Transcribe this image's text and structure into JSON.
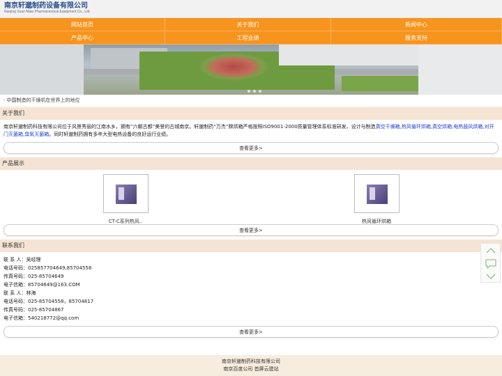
{
  "header": {
    "company_cn": "南京轩邈制药设备有限公司",
    "company_en": "Nanjing Xuan Miao Pharmaceutical Equipment Co., Ltd."
  },
  "nav": [
    "网站首页",
    "关于我们",
    "新闻中心",
    "产品中心",
    "工程业绩",
    "服务支持"
  ],
  "banner": {
    "caption": "· 中国制造的干燥机在世界上的地位"
  },
  "about": {
    "title": "关于我们",
    "text_before": "南京轩邈制药科技有限公司位于风景秀丽的江南水乡，拥有“六朝古都”美誉的古城南京。轩邈制药“万杰”牌烘箱严格按照ISO9001-2000质量管理体系标准研发、设计与制造",
    "links": "真空干燥箱,热风循环烘箱,真空烘箱,电热鼓风烘箱,对开门灭菌箱,臭氧灭菌箱",
    "text_after": "。同时轩邈制药拥有多年大型电热设备的良好运行业绩。",
    "more": "查看更多>"
  },
  "products": {
    "title": "产品展示",
    "items": [
      {
        "name": "CT-C系列热风.."
      },
      {
        "name": "热风循环烘箱"
      }
    ],
    "more": "查看更多>"
  },
  "contact": {
    "title": "联系我们",
    "lines": [
      "联 系 人：吴经理",
      "电话号码：025857704649,85704558",
      "传真号码：025-85704649",
      "电子信箱：85704649@163.COM",
      "联 系 人：林海",
      "电话号码：025-85704558，85704817",
      "传真号码：025-85704867",
      "电子信箱：540218772@qq.com"
    ],
    "more": "查看更多>"
  },
  "footer": {
    "line1": "南京轩邈制药科技有限公司",
    "line2": "南京百度公司 首屏云建站"
  },
  "side_icons": [
    "chevron-up-icon",
    "chat-icon",
    "chevron-down-icon"
  ],
  "colors": {
    "nav": "#f7941d",
    "section_bg": "#f5e4d3",
    "link": "#1a3bcf",
    "footer_bg": "#f7eddf"
  }
}
